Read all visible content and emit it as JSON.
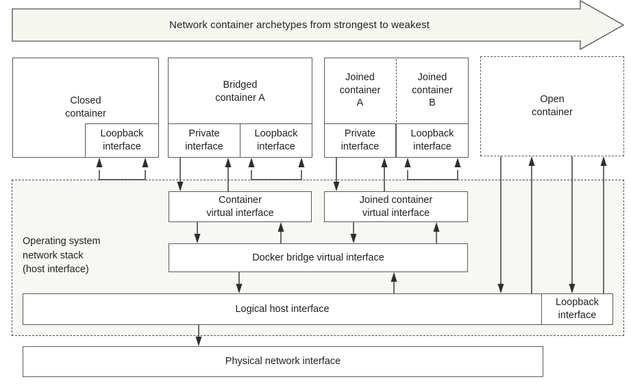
{
  "diagram": {
    "title": "Network container archetypes from strongest to weakest",
    "banner": {
      "label": "Network container archetypes from strongest to weakest",
      "fill": "#f6f6f1",
      "stroke": "#6e6e6e"
    },
    "containers": [
      {
        "id": "closed",
        "name": "Closed\ncontainer",
        "line1": "Closed",
        "line2": "container",
        "style": "solid",
        "interfaces": [
          {
            "id": "closed-loopback",
            "line1": "Loopback",
            "line2": "interface"
          }
        ]
      },
      {
        "id": "bridged",
        "name": "Bridged\ncontainer A",
        "line1": "Bridged",
        "line2": "container A",
        "style": "solid",
        "interfaces": [
          {
            "id": "bridged-private",
            "line1": "Private",
            "line2": "interface"
          },
          {
            "id": "bridged-loopback",
            "line1": "Loopback",
            "line2": "interface"
          }
        ]
      },
      {
        "id": "joined-a",
        "name": "Joined container A",
        "line1": "Joined",
        "line2": "container",
        "line3": "A",
        "style": "solid",
        "interfaces": [
          {
            "id": "joined-private",
            "line1": "Private",
            "line2": "interface"
          }
        ]
      },
      {
        "id": "joined-b",
        "name": "Joined container B",
        "line1": "Joined",
        "line2": "container",
        "line3": "B",
        "style": "solid-dashed-divider",
        "interfaces": [
          {
            "id": "joined-loopback",
            "line1": "Loopback",
            "line2": "interface"
          }
        ]
      },
      {
        "id": "open",
        "name": "Open\ncontainer",
        "line1": "Open",
        "line2": "container",
        "style": "dashed",
        "interfaces": []
      }
    ],
    "os_stack": {
      "label_line1": "Operating system",
      "label_line2": "network stack",
      "label_line3": "(host interface)",
      "fill": "#f7f7f4",
      "border": "#4a4a4a",
      "boxes": [
        {
          "id": "container-virtual",
          "line1": "Container",
          "line2": "virtual interface"
        },
        {
          "id": "joined-container-virtual",
          "line1": "Joined container",
          "line2": "virtual interface"
        },
        {
          "id": "docker-bridge",
          "line1": "Docker bridge virtual interface"
        },
        {
          "id": "logical-host",
          "line1": "Logical host interface"
        },
        {
          "id": "host-loopback",
          "line1": "Loopback",
          "line2": "interface"
        }
      ]
    },
    "physical": {
      "id": "physical-network",
      "line1": "Physical network interface"
    }
  }
}
